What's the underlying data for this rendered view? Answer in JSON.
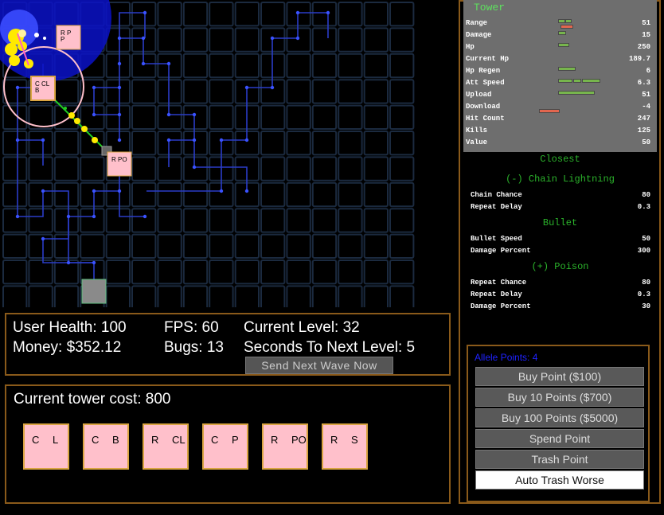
{
  "status": {
    "user_health": "User Health: 100",
    "money": "Money: $352.12",
    "fps": "FPS: 60",
    "bugs": "Bugs: 13",
    "current_level": "Current Level: 32",
    "seconds_next": "Seconds To Next Level: 5",
    "send_wave": "Send  Next  Wave  Now"
  },
  "shop": {
    "cost_label": "Current tower cost: 800",
    "towers": [
      {
        "a": "C",
        "b": "L"
      },
      {
        "a": "C",
        "b": "B"
      },
      {
        "a": "R",
        "b": "CL"
      },
      {
        "a": "C",
        "b": "P"
      },
      {
        "a": "R",
        "b": "PO"
      },
      {
        "a": "R",
        "b": "S"
      }
    ]
  },
  "board": {
    "towers": [
      {
        "top": "R  P",
        "bottom": "P"
      },
      {
        "top": "C  CL",
        "bottom": "B"
      },
      {
        "top": "R  PO",
        "bottom": ""
      }
    ]
  },
  "tower_panel": {
    "title": "Tower",
    "stats": [
      {
        "label": "Range",
        "value": "51"
      },
      {
        "label": "Damage",
        "value": "15"
      },
      {
        "label": "Hp",
        "value": "250"
      },
      {
        "label": "Current Hp",
        "value": "189.7"
      },
      {
        "label": "Hp Regen",
        "value": "6"
      },
      {
        "label": "Att Speed",
        "value": "6.3"
      },
      {
        "label": "Upload",
        "value": "51"
      },
      {
        "label": "Download",
        "value": "-4"
      },
      {
        "label": "Hit Count",
        "value": "247"
      },
      {
        "label": "Kills",
        "value": "125"
      },
      {
        "label": "Value",
        "value": "50"
      }
    ],
    "targeting": "Closest",
    "chain_title": "(-) Chain Lightning",
    "chain": [
      {
        "label": "Chain Chance",
        "value": "80"
      },
      {
        "label": "Repeat Delay",
        "value": "0.3"
      }
    ],
    "bullet_title": "Bullet",
    "bullet": [
      {
        "label": "Bullet Speed",
        "value": "50"
      },
      {
        "label": "Damage Percent",
        "value": "300"
      }
    ],
    "poison_title": "(+) Poison",
    "poison": [
      {
        "label": "Repeat Chance",
        "value": "80"
      },
      {
        "label": "Repeat Delay",
        "value": "0.3"
      },
      {
        "label": "Damage Percent",
        "value": "30"
      }
    ]
  },
  "points": {
    "allele": "Allele Points: 4",
    "buttons": [
      "Buy  Point  ($100)",
      "Buy  10  Points  ($700)",
      "Buy  100  Points  ($5000)",
      "Spend  Point",
      "Trash  Point",
      "Auto  Trash  Worse"
    ]
  },
  "colors": {
    "panel_border": "#8a5a1a",
    "tower_fill": "#ffc0cb",
    "stat_bar_green": "#77b54d",
    "stat_bar_red": "#e2664f",
    "section_green": "#2bb32b",
    "allele_blue": "#1e22ff"
  }
}
